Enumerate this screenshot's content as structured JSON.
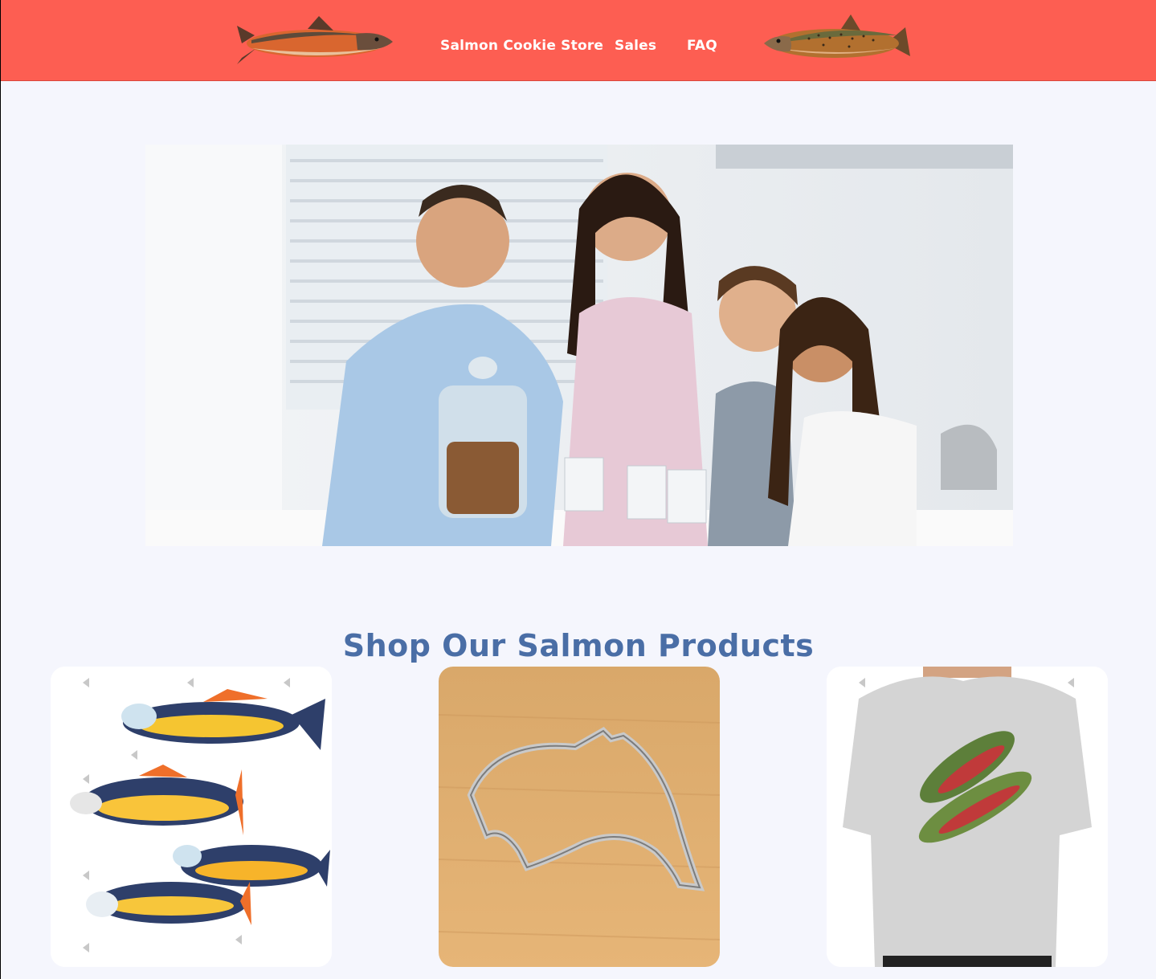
{
  "nav": {
    "links": [
      "Salmon Cookie Store",
      "Sales",
      "FAQ"
    ],
    "left_fish_icon": "salmon-illustration-icon",
    "right_fish_icon": "trout-illustration-icon"
  },
  "hero": {
    "image_subject": "family-with-cookie-jar-photo"
  },
  "products": {
    "title": "Shop Our Salmon Products",
    "cards": [
      {
        "image": "decorated-salmon-cookies"
      },
      {
        "image": "salmon-cookie-cutter"
      },
      {
        "image": "salmon-t-shirt"
      }
    ]
  },
  "colors": {
    "header": "#fd5e52",
    "page_background": "#f5f6fd",
    "title": "#4a6ea6",
    "nav_text": "#ffffff"
  }
}
